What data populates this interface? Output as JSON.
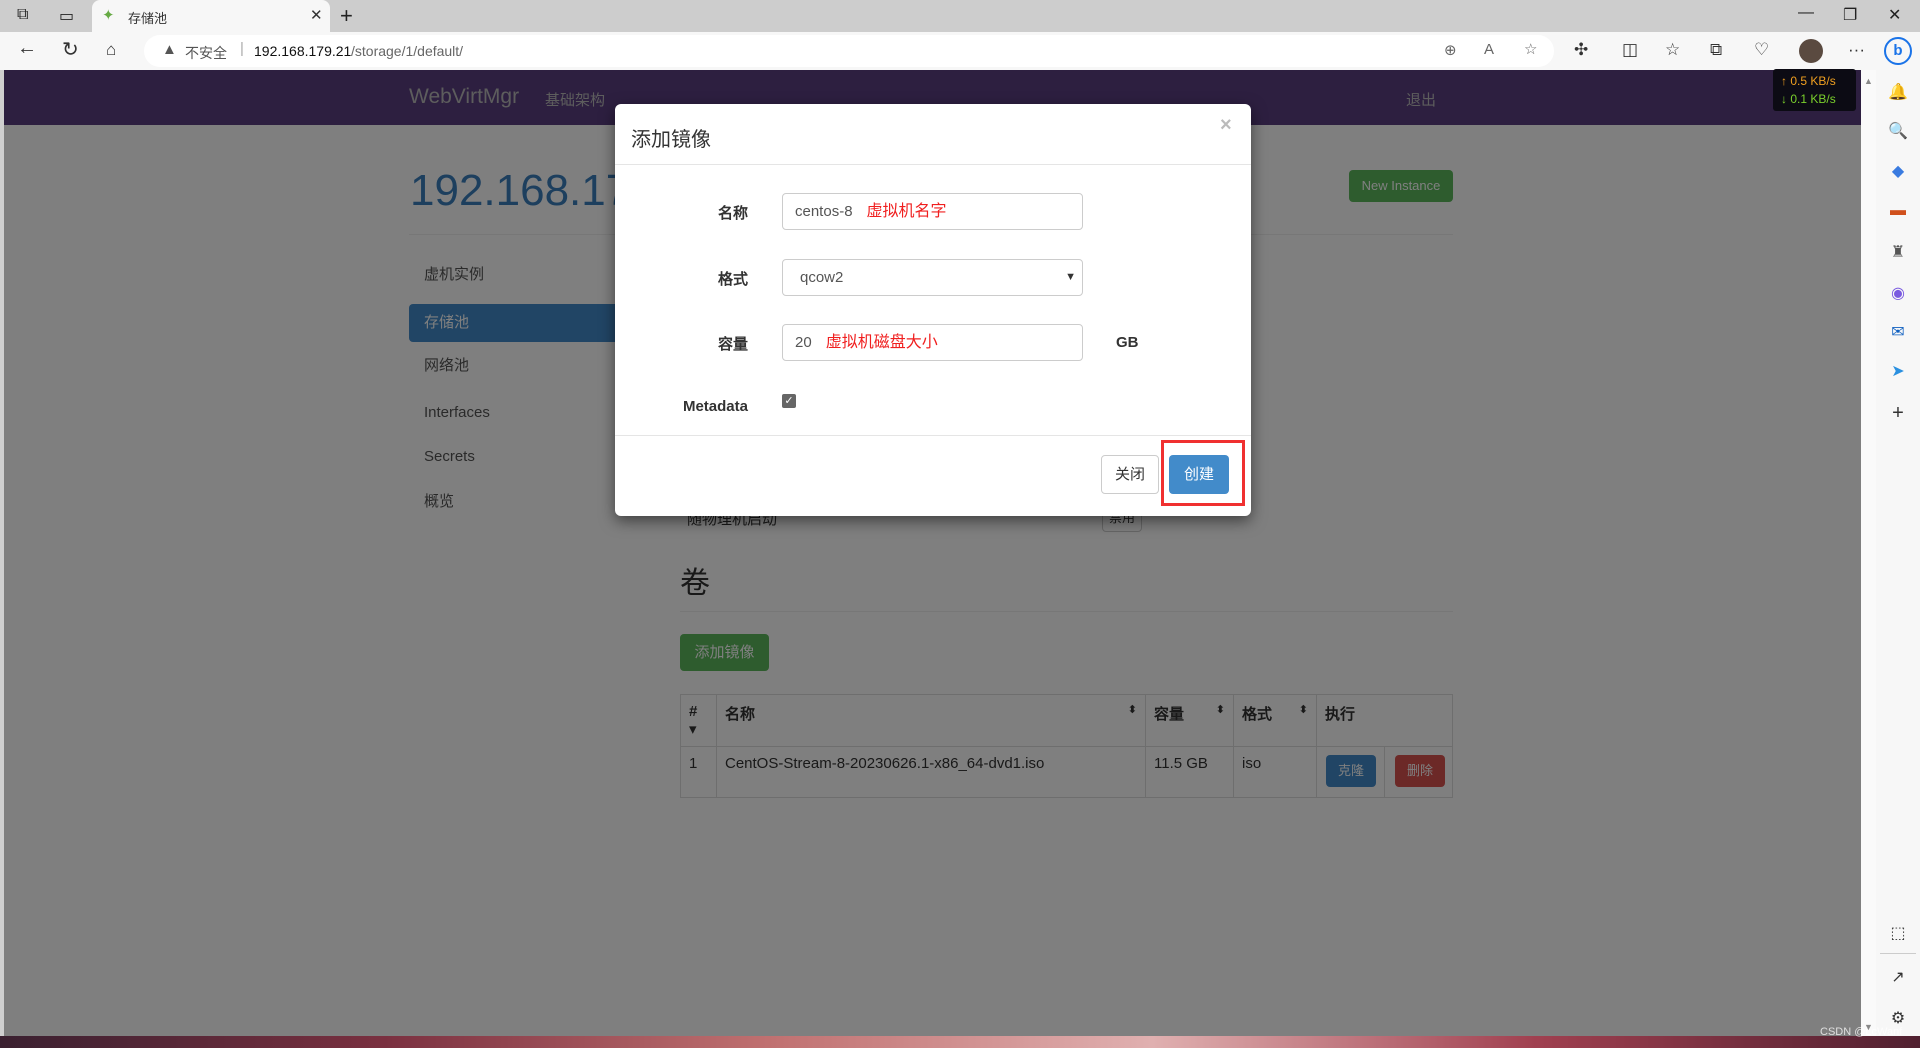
{
  "browser": {
    "tab_title": "存储池",
    "address_warning": "不安全",
    "url_host": "192.168.179.21",
    "url_path": "/storage/1/default/",
    "netspeed": {
      "up": "↑ 0.5 KB/s",
      "down": "↓ 0.1 KB/s",
      "up_color": "#f0a020",
      "down_color": "#7ad02c"
    }
  },
  "navbar": {
    "brand": "WebVirtMgr",
    "infra": "基础架构",
    "logout": "退出"
  },
  "page": {
    "title": "192.168.179.21",
    "new_instance": "New Instance",
    "sidebar": [
      {
        "label": "虚机实例"
      },
      {
        "label": "存储池",
        "active": true
      },
      {
        "label": "网络池"
      },
      {
        "label": "Interfaces"
      },
      {
        "label": "Secrets"
      },
      {
        "label": "概览"
      }
    ],
    "autostart_label": "随物理机启动",
    "autostart_btn": "禁用",
    "volumes_heading": "卷",
    "add_image": "添加镜像",
    "table": {
      "headers": [
        "#",
        "名称",
        "容量",
        "格式",
        "执行"
      ],
      "rows": [
        {
          "index": "1",
          "name": "CentOS-Stream-8-20230626.1-x86_64-dvd1.iso",
          "size": "11.5 GB",
          "format": "iso",
          "clone": "克隆",
          "delete": "删除"
        }
      ]
    }
  },
  "modal": {
    "title": "添加镜像",
    "close_x": "×",
    "name_label": "名称",
    "name_value": "centos-8",
    "name_note": "虚拟机名字",
    "format_label": "格式",
    "format_value": "qcow2",
    "capacity_label": "容量",
    "capacity_value": "20",
    "capacity_note": "虚拟机磁盘大小",
    "capacity_unit": "GB",
    "metadata_label": "Metadata",
    "metadata_checked": true,
    "close_btn": "关闭",
    "create_btn": "创建"
  },
  "watermark": "CSDN @LcWanf"
}
